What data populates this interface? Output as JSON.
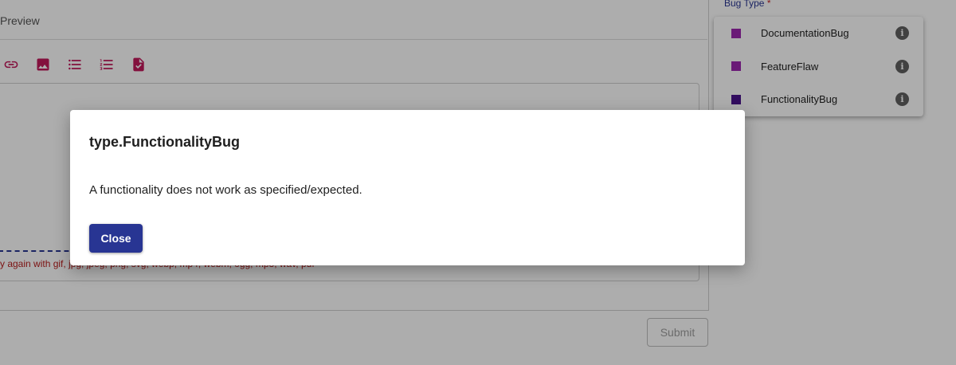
{
  "editor": {
    "tab_preview_label": "Preview",
    "toolbar_icons": [
      "link-icon",
      "image-icon",
      "bulleted-list-icon",
      "numbered-list-icon",
      "task-list-icon"
    ],
    "upload_error_text": "y again with gif, jpg, jpeg, png, svg, webp, mp4, webm, ogg, mp3, wav, pdf"
  },
  "submit_label": "Submit",
  "bug_type": {
    "label": "Bug Type",
    "required_marker": "*",
    "options": [
      {
        "label": "DocumentationBug",
        "color": "#9c27b0"
      },
      {
        "label": "FeatureFlaw",
        "color": "#9c27b0"
      },
      {
        "label": "FunctionalityBug",
        "color": "#4a148c"
      }
    ],
    "info_glyph": "i"
  },
  "dialog": {
    "title": "type.FunctionalityBug",
    "description": "A functionality does not work as specified/expected.",
    "close_label": "Close"
  },
  "colors": {
    "accent": "#283593",
    "toolbar_icon": "#c2185b",
    "error": "#b71c1c"
  }
}
